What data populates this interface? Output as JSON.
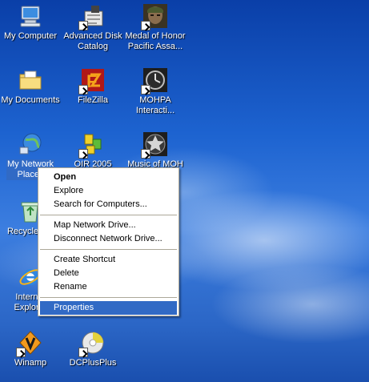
{
  "desktop_icons": [
    {
      "id": "my-computer",
      "label": "My Computer",
      "icon": "computer-icon"
    },
    {
      "id": "advanced-disk-catalog",
      "label": "Advanced Disk\nCatalog",
      "icon": "disk-catalog-icon"
    },
    {
      "id": "medal-of-honor",
      "label": "Medal of Honor\nPacific Assa...",
      "icon": "soldier-icon"
    },
    {
      "id": "my-documents",
      "label": "My Documents",
      "icon": "folder-icon"
    },
    {
      "id": "filezilla",
      "label": "FileZilla",
      "icon": "filezilla-icon"
    },
    {
      "id": "mohpa",
      "label": "MOHPA\nInteracti...",
      "icon": "clock-icon"
    },
    {
      "id": "my-network-places",
      "label": "My Network\nPlaces",
      "icon": "network-icon"
    },
    {
      "id": "oir",
      "label": "OIR 2005",
      "icon": "puzzle-icon"
    },
    {
      "id": "music-of-moh",
      "label": "Music of MOH",
      "icon": "star-icon"
    },
    {
      "id": "recycle-bin",
      "label": "Recycle Bin",
      "icon": "recycle-icon"
    },
    {
      "id": "internet-explorer",
      "label": "Internet\nExplorer",
      "icon": "ie-icon"
    },
    {
      "id": "winamp",
      "label": "Winamp",
      "icon": "winamp-icon"
    },
    {
      "id": "dcplusplus",
      "label": "DCPlusPlus",
      "icon": "dcplusplus-icon"
    }
  ],
  "context_menu": {
    "items": [
      {
        "label": "Open"
      },
      {
        "label": "Explore"
      },
      {
        "label": "Search for Computers..."
      },
      {
        "label": "Map Network Drive..."
      },
      {
        "label": "Disconnect Network Drive..."
      },
      {
        "label": "Create Shortcut"
      },
      {
        "label": "Delete"
      },
      {
        "label": "Rename"
      },
      {
        "label": "Properties"
      }
    ]
  },
  "colors": {
    "selection": "#316ac5",
    "menu_border": "#aca899"
  }
}
